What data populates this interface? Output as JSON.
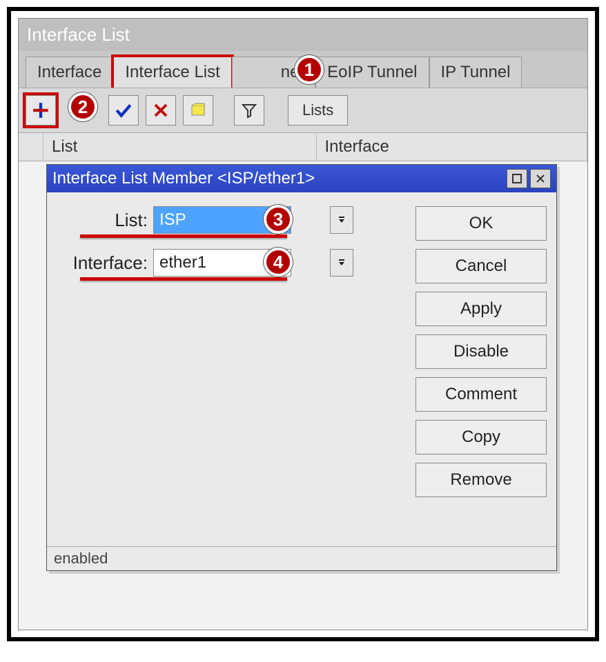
{
  "window": {
    "title": "Interface List"
  },
  "tabs": {
    "interface": "Interface",
    "interface_list": "Interface List",
    "ethernet_fragment": "net",
    "eoip": "EoIP Tunnel",
    "ip_tunnel": "IP Tunnel"
  },
  "toolbar": {
    "lists_btn": "Lists"
  },
  "columns": {
    "list": "List",
    "interface": "Interface"
  },
  "dialog": {
    "title": "Interface List Member <ISP/ether1>",
    "labels": {
      "list": "List:",
      "interface": "Interface:"
    },
    "values": {
      "list": "ISP",
      "interface": "ether1"
    },
    "buttons": {
      "ok": "OK",
      "cancel": "Cancel",
      "apply": "Apply",
      "disable": "Disable",
      "comment": "Comment",
      "copy": "Copy",
      "remove": "Remove"
    },
    "status": "enabled"
  },
  "badges": {
    "b1": "1",
    "b2": "2",
    "b3": "3",
    "b4": "4"
  }
}
